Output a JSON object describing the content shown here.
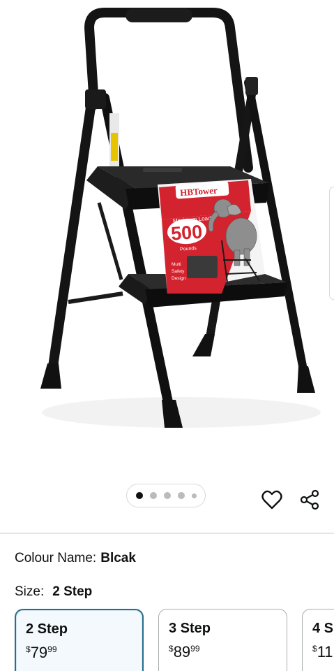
{
  "product": {
    "image": {
      "brand_logo": "HBTower",
      "badge_line1": "Maximum Load",
      "badge_value": "500",
      "badge_unit": "Pounds",
      "badge_feature": "Multi Safety Design"
    },
    "carousel": {
      "dot_count": 5,
      "active_index": 0
    }
  },
  "actions": {
    "wishlist_icon": "heart-outline-icon",
    "share_icon": "share-icon"
  },
  "variations": {
    "colour_label": "Colour Name:",
    "colour_value": "Blcak",
    "size_label": "Size:",
    "size_value": "2 Step",
    "sizes": [
      {
        "name": "2 Step",
        "currency": "$",
        "whole": "79",
        "cents": "99",
        "selected": true
      },
      {
        "name": "3 Step",
        "currency": "$",
        "whole": "89",
        "cents": "99",
        "selected": false
      },
      {
        "name": "4 S",
        "currency": "$",
        "whole": "11",
        "cents": "",
        "selected": false
      }
    ]
  },
  "colors": {
    "selected_border": "#2a6c8e",
    "badge_red": "#d3232f",
    "text": "#0f1111"
  }
}
